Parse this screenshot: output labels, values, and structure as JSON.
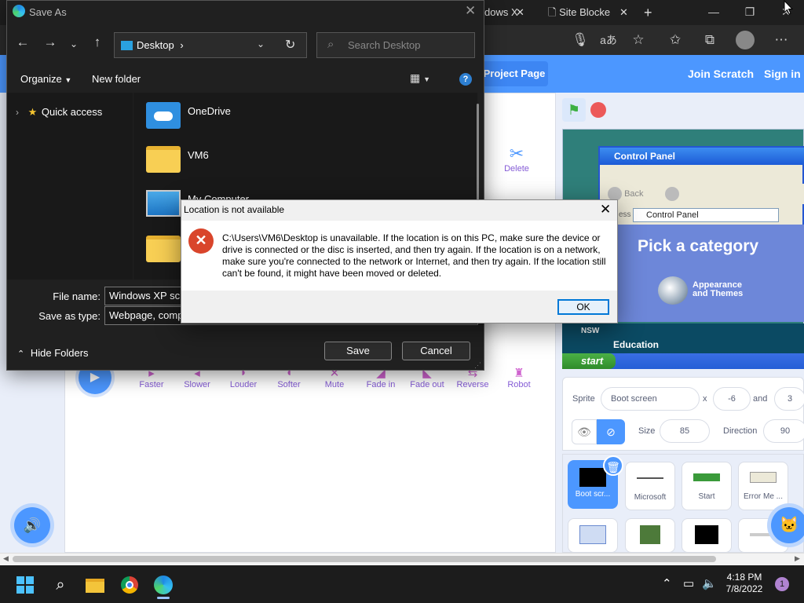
{
  "browser": {
    "tabs": [
      {
        "label": "dows X",
        "close": "✕"
      },
      {
        "label": "Site Blocke",
        "close": "✕"
      }
    ],
    "new_tab": "+",
    "window_controls": {
      "minimize": "—",
      "restore": "❐",
      "close": "✕"
    }
  },
  "scratch": {
    "menu": {
      "project_page": "Project Page",
      "join": "Join Scratch",
      "signin": "Sign in"
    },
    "delete_label": "Delete",
    "sound_effects": [
      "Faster",
      "Slower",
      "Louder",
      "Softer",
      "Mute",
      "Fade in",
      "Fade out",
      "Reverse",
      "Robot"
    ],
    "stage": {
      "xp_title": "Control Panel",
      "xp_back": "Back",
      "xp_address_prefix": "ess",
      "xp_address": "Control Panel",
      "pick_category": "Pick a category",
      "appearance": "Appearance",
      "themes": "and Themes",
      "nsw": "NSW",
      "education": "Education",
      "start": "start"
    },
    "sprite_info": {
      "sprite_label": "Sprite",
      "sprite_name": "Boot screen",
      "x_label": "x",
      "x_value": "-6",
      "and_label": "and",
      "y_value": "3",
      "size_label": "Size",
      "size_value": "85",
      "direction_label": "Direction",
      "direction_value": "90"
    },
    "sprites": [
      {
        "name": "Boot scr...",
        "selected": true
      },
      {
        "name": "Microsoft",
        "selected": false
      },
      {
        "name": "Start",
        "selected": false
      },
      {
        "name": "Error Me ...",
        "selected": false
      }
    ]
  },
  "save_as": {
    "title": "Save As",
    "address": "Desktop",
    "search_placeholder": "Search Desktop",
    "organize": "Organize",
    "new_folder": "New folder",
    "quick_access": "Quick access",
    "files": [
      {
        "name": "OneDrive",
        "icon": "onedrive-folder-icon"
      },
      {
        "name": "VM6",
        "icon": "folder-icon"
      },
      {
        "name": "My Computer",
        "icon": "computer-icon"
      }
    ],
    "file_name_label": "File name:",
    "file_name_value": "Windows XP scho",
    "save_type_label": "Save as type:",
    "save_type_value": "Webpage, comple",
    "hide_folders": "Hide Folders",
    "save_button": "Save",
    "cancel_button": "Cancel"
  },
  "error_dialog": {
    "title": "Location is not available",
    "message": "C:\\Users\\VM6\\Desktop is unavailable. If the location is on this PC, make sure the device or drive is connected or the disc is inserted, and then try again. If the location is on a network, make sure you're connected to the network or Internet, and then try again. If the location still can't be found, it might have been moved or deleted.",
    "ok": "OK"
  },
  "taskbar": {
    "time": "4:18 PM",
    "date": "7/8/2022",
    "notifications": "1"
  }
}
